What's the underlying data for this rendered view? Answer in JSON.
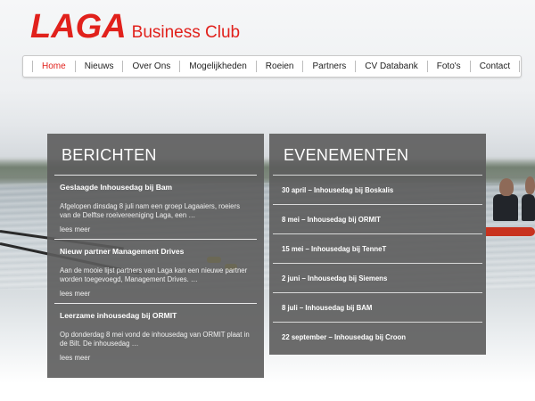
{
  "brand": {
    "logo_text": "LAGA",
    "tagline": "Business Club",
    "color": "#e1211c"
  },
  "nav": {
    "items": [
      {
        "label": "Home",
        "active": true
      },
      {
        "label": "Nieuws"
      },
      {
        "label": "Over Ons"
      },
      {
        "label": "Mogelijkheden"
      },
      {
        "label": "Roeien"
      },
      {
        "label": "Partners"
      },
      {
        "label": "CV Databank"
      },
      {
        "label": "Foto's"
      },
      {
        "label": "Contact"
      }
    ]
  },
  "berichten": {
    "title": "BERICHTEN",
    "posts": [
      {
        "title": "Geslaagde Inhousedag bij Bam",
        "excerpt": "Afgelopen dinsdag 8 juli nam een groep Lagaaiers, roeiers van de Delftse roeivereeniging Laga, een …",
        "more": "lees meer"
      },
      {
        "title": "Nieuw partner Management Drives",
        "excerpt": "Aan de mooie lijst partners van Laga kan een nieuwe partner worden toegevoegd, Management Drives. …",
        "more": "lees meer"
      },
      {
        "title": "Leerzame inhousedag bij ORMIT",
        "excerpt": "Op donderdag 8 mei vond de inhousedag van ORMIT plaat in de Bilt. De inhousedag …",
        "more": "lees meer"
      }
    ]
  },
  "evenementen": {
    "title": "EVENEMENTEN",
    "items": [
      "30 april – Inhousedag bij Boskalis",
      "8 mei – Inhousedag bij ORMIT",
      "15 mei – Inhousedag bij TenneT",
      "2 juni – Inhousedag bij Siemens",
      "8 juli – Inhousedag bij BAM",
      "22 september – Inhousedag bij Croon"
    ]
  }
}
